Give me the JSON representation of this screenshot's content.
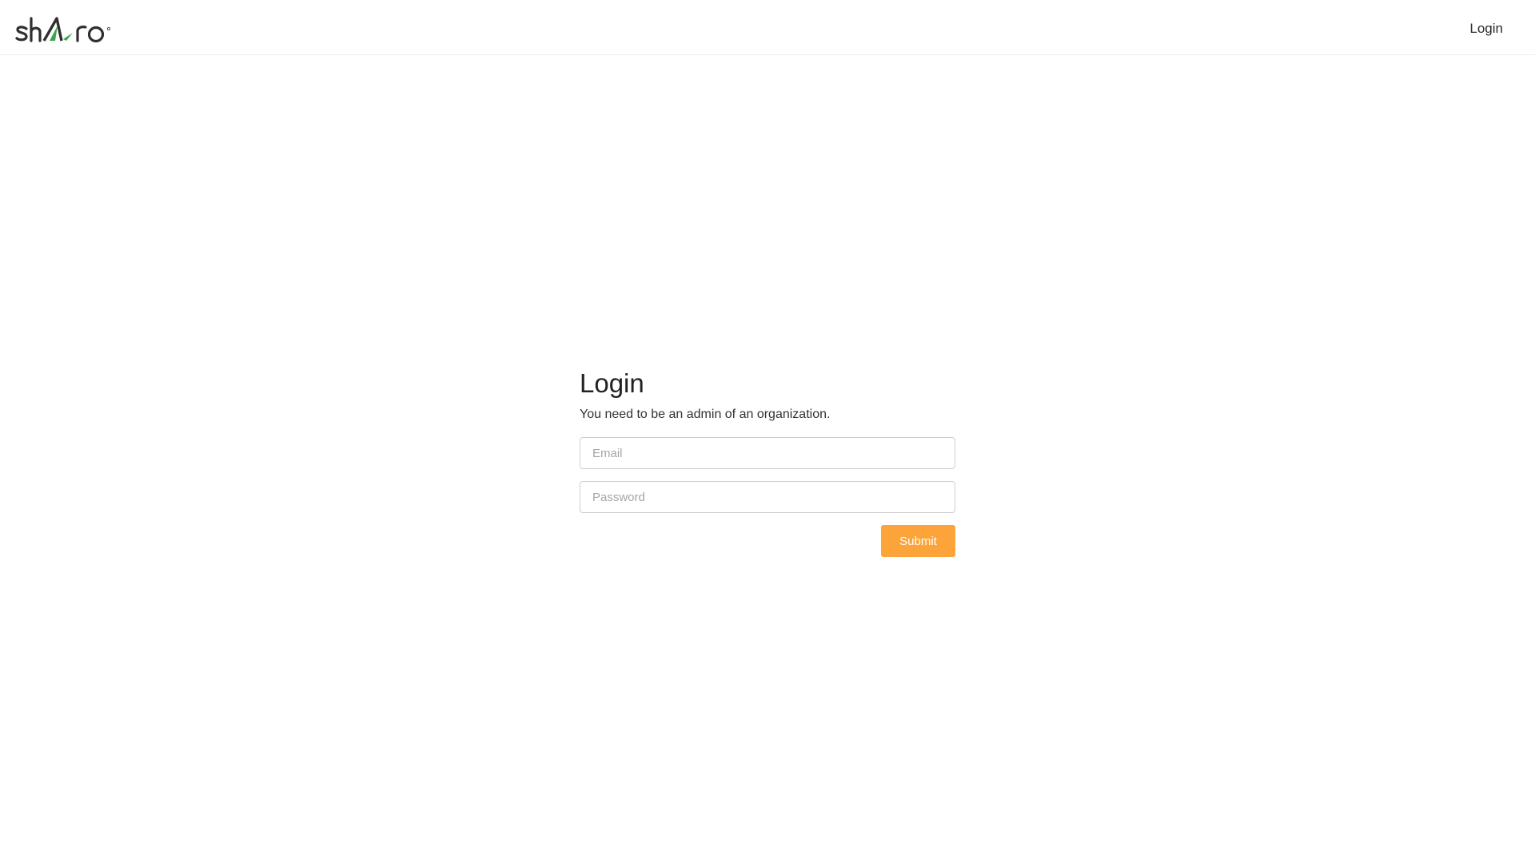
{
  "header": {
    "logo_alt": "sharo",
    "nav_login_label": "Login"
  },
  "login": {
    "title": "Login",
    "subtitle": "You need to be an admin of an organization.",
    "email_placeholder": "Email",
    "email_value": "",
    "password_placeholder": "Password",
    "password_value": "",
    "submit_label": "Submit"
  },
  "colors": {
    "accent": "#fca33a",
    "logo_green": "#3aa64a",
    "logo_dark": "#2f2f2f"
  },
  "icons": {
    "logo": "sharo-logo"
  }
}
